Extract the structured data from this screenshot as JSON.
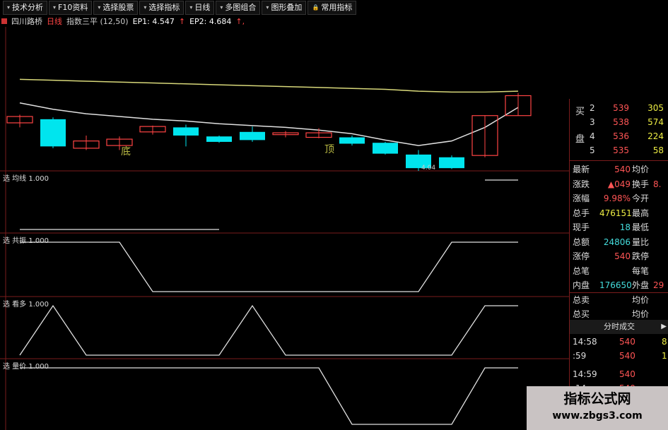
{
  "toolbar": {
    "buttons": [
      "技术分析",
      "F10资料",
      "选择股票",
      "选择指标",
      "日线",
      "多图组合",
      "图形叠加",
      "常用指标"
    ]
  },
  "title": {
    "stock": "四川路桥",
    "period": "日线",
    "indicator": "指数三平 (12,50)",
    "ep1": "EP1: 4.547",
    "ep2": "EP2: 4.684",
    "arrow": "↑,"
  },
  "annotations": {
    "bottom": "底",
    "top": "顶",
    "price_mark": "4.04"
  },
  "panels": [
    {
      "label": "选 均线  1.000"
    },
    {
      "label": "选 共振  1.000"
    },
    {
      "label": "选 看多  1.000"
    },
    {
      "label": "选 量价  1.000"
    }
  ],
  "order_book": {
    "buy_side_label": "买",
    "board_label": "盘",
    "levels": [
      {
        "level": "2",
        "price": "539",
        "volume": "305"
      },
      {
        "level": "3",
        "price": "538",
        "volume": "574"
      },
      {
        "level": "4",
        "price": "536",
        "volume": "224"
      },
      {
        "level": "5",
        "price": "535",
        "volume": "58"
      }
    ]
  },
  "stats": [
    {
      "label": "最新",
      "value": "540",
      "value_color": "#ff5555",
      "label2": "均价",
      "value2": ""
    },
    {
      "label": "涨跌",
      "value": "▲049",
      "value_color": "#ff5555",
      "label2": "换手",
      "value2": "8."
    },
    {
      "label": "涨幅",
      "value": "9.98%",
      "value_color": "#ff5555",
      "label2": "今开",
      "value2": ""
    },
    {
      "label": "总手",
      "value": "476151",
      "value_color": "#eeee44",
      "label2": "最高",
      "value2": ""
    },
    {
      "label": "现手",
      "value": "18",
      "value_color": "#44dddd",
      "label2": "最低",
      "value2": ""
    },
    {
      "label": "总额",
      "value": "24806",
      "value_color": "#44dddd",
      "label2": "量比",
      "value2": ""
    },
    {
      "label": "涨停",
      "value": "540",
      "value_color": "#ff5555",
      "label2": "跌停",
      "value2": ""
    },
    {
      "label": "总笔",
      "value": "",
      "value_color": "#dddddd",
      "label2": "每笔",
      "value2": ""
    },
    {
      "label": "内盘",
      "value": "176650",
      "value_color": "#44dddd",
      "label2": "外盘",
      "value2": "29"
    },
    {
      "label": "总卖",
      "value": "",
      "value_color": "#dddddd",
      "label2": "均价",
      "value2": ""
    },
    {
      "label": "总买",
      "value": "",
      "value_color": "#dddddd",
      "label2": "均价",
      "value2": ""
    }
  ],
  "tick_panel": {
    "title": "分时成交",
    "arrow": "▶",
    "rows": [
      {
        "time": "14:58",
        "price": "540",
        "extra": "8"
      },
      {
        "time": ":59",
        "price": "540",
        "extra": "1"
      },
      {
        "time": "14:59",
        "price": "540",
        "extra": ""
      },
      {
        "time": ":14",
        "price": "540",
        "extra": ""
      }
    ]
  },
  "watermark": {
    "line1": "指标公式网",
    "line2": "www.zbgs3.com"
  },
  "colors": {
    "up_candle": "#ff4444",
    "down_candle": "#00e5ee",
    "ma_short": "#e0e0e0",
    "ma_long": "#d8d87a",
    "divider": "#7a1c1c",
    "signal_line": "#e0e0e0",
    "annotation_text": "#bbbb44"
  },
  "chart_data": {
    "type": "candlestick",
    "note_units": "price",
    "candles": [
      {
        "o": 4.85,
        "c": 4.78,
        "h": 4.87,
        "l": 4.73,
        "dir": "down",
        "style": "hollow"
      },
      {
        "o": 4.82,
        "c": 4.52,
        "h": 4.84,
        "l": 4.5,
        "dir": "down",
        "style": "solid"
      },
      {
        "o": 4.58,
        "c": 4.5,
        "h": 4.64,
        "l": 4.48,
        "dir": "down",
        "style": "hollow"
      },
      {
        "o": 4.6,
        "c": 4.53,
        "h": 4.63,
        "l": 4.48,
        "dir": "down",
        "style": "hollow"
      },
      {
        "o": 4.68,
        "c": 4.74,
        "h": 4.75,
        "l": 4.65,
        "dir": "up",
        "style": "hollow"
      },
      {
        "o": 4.73,
        "c": 4.64,
        "h": 4.76,
        "l": 4.52,
        "dir": "down",
        "style": "solid"
      },
      {
        "o": 4.63,
        "c": 4.57,
        "h": 4.64,
        "l": 4.56,
        "dir": "down",
        "style": "solid"
      },
      {
        "o": 4.68,
        "c": 4.59,
        "h": 4.74,
        "l": 4.57,
        "dir": "down",
        "style": "solid"
      },
      {
        "o": 4.67,
        "c": 4.65,
        "h": 4.69,
        "l": 4.62,
        "dir": "down",
        "style": "hollow"
      },
      {
        "o": 4.67,
        "c": 4.62,
        "h": 4.72,
        "l": 4.61,
        "dir": "down",
        "style": "hollow"
      },
      {
        "o": 4.62,
        "c": 4.55,
        "h": 4.64,
        "l": 4.53,
        "dir": "down",
        "style": "solid"
      },
      {
        "o": 4.56,
        "c": 4.44,
        "h": 4.57,
        "l": 4.43,
        "dir": "down",
        "style": "solid"
      },
      {
        "o": 4.43,
        "c": 4.28,
        "h": 4.48,
        "l": 4.25,
        "dir": "down",
        "style": "solid"
      },
      {
        "o": 4.4,
        "c": 4.28,
        "h": 4.42,
        "l": 4.27,
        "dir": "down",
        "style": "solid"
      },
      {
        "o": 4.42,
        "c": 4.86,
        "h": 4.86,
        "l": 4.4,
        "dir": "up",
        "style": "hollow"
      },
      {
        "o": 4.86,
        "c": 5.08,
        "h": 5.11,
        "l": 4.86,
        "dir": "up",
        "style": "hollow"
      }
    ],
    "ma_long": [
      5.26,
      5.25,
      5.24,
      5.23,
      5.22,
      5.21,
      5.2,
      5.19,
      5.18,
      5.17,
      5.16,
      5.15,
      5.13,
      5.12,
      5.12,
      5.13
    ],
    "ma_short": [
      5.0,
      4.93,
      4.88,
      4.85,
      4.82,
      4.8,
      4.77,
      4.75,
      4.73,
      4.7,
      4.66,
      4.59,
      4.53,
      4.58,
      4.73,
      4.95
    ],
    "ylim": [
      4.25,
      5.45
    ],
    "signals": {
      "均线": [
        0,
        0,
        0,
        0,
        0,
        0,
        0,
        null,
        null,
        null,
        null,
        null,
        null,
        null,
        1,
        1
      ],
      "共振": [
        1,
        1,
        1,
        1,
        0,
        0,
        0,
        0,
        0,
        0,
        0,
        0,
        0,
        1,
        1,
        1
      ],
      "看多": [
        0,
        1,
        0,
        0,
        0,
        0,
        0,
        1,
        0,
        0,
        0,
        0,
        0,
        0,
        1,
        1
      ],
      "量价": [
        1,
        1,
        1,
        1,
        1,
        1,
        1,
        1,
        1,
        1,
        0,
        0,
        0,
        0,
        1,
        1
      ]
    }
  }
}
